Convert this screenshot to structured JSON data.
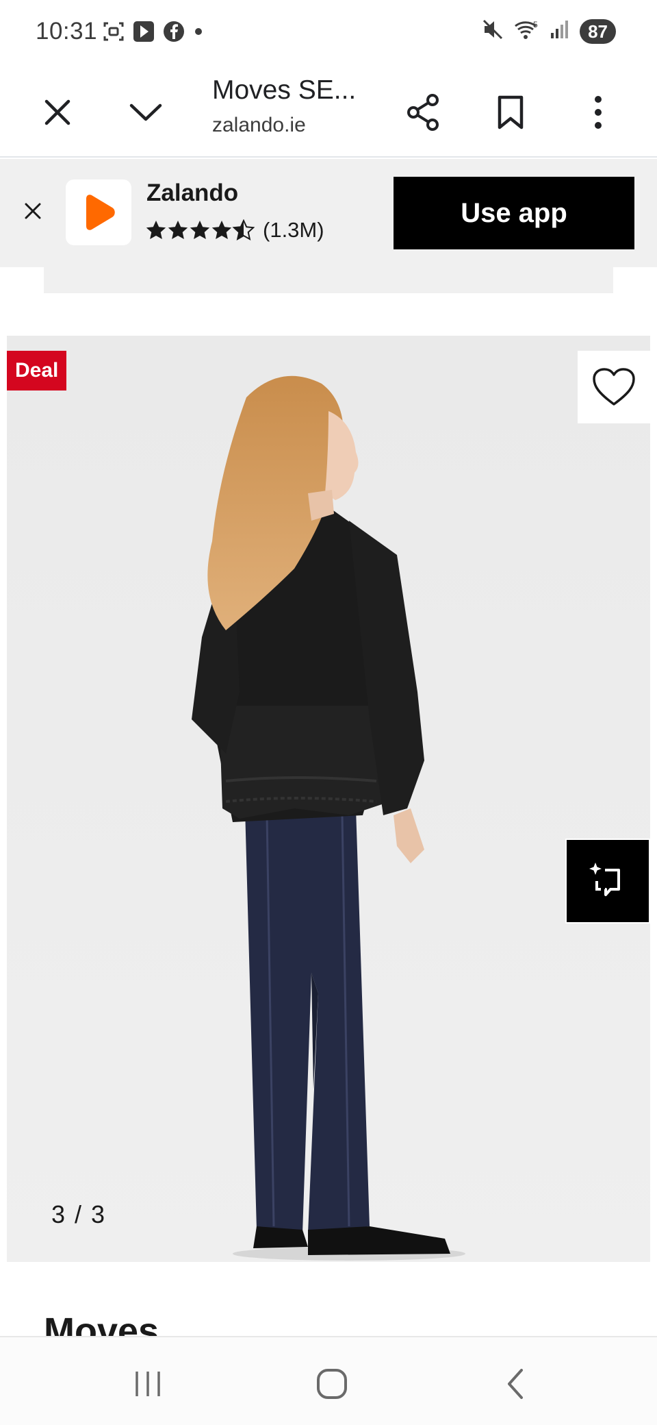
{
  "status_bar": {
    "time": "10:31",
    "battery": "87",
    "signal_label": "5"
  },
  "browser": {
    "page_title": "Moves SE...",
    "url": "zalando.ie",
    "icons": [
      "close-icon",
      "chevron-down-icon",
      "share-icon",
      "bookmark-icon",
      "more-vert-icon"
    ]
  },
  "app_banner": {
    "app_name": "Zalando",
    "rating_count": "(1.3M)",
    "rating_stars": 4.5,
    "cta_label": "Use app",
    "brand_color": "#ff6900"
  },
  "product": {
    "deal_label": "Deal",
    "deal_color": "#d4061f",
    "image_counter": "3 / 3",
    "image_index": 3,
    "image_total": 3,
    "brand_name": "Moves"
  },
  "nav": {
    "icons": [
      "recent-apps-icon",
      "home-icon",
      "back-icon"
    ]
  }
}
